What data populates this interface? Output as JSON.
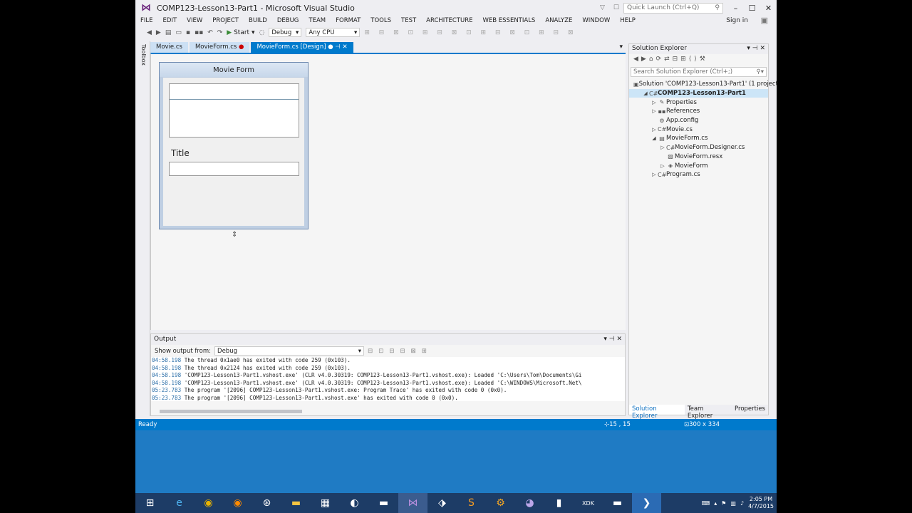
{
  "window": {
    "title": "COMP123-Lesson13-Part1 - Microsoft Visual Studio",
    "quick_launch_placeholder": "Quick Launch (Ctrl+Q)",
    "sign_in": "Sign in"
  },
  "menu": [
    "FILE",
    "EDIT",
    "VIEW",
    "PROJECT",
    "BUILD",
    "DEBUG",
    "TEAM",
    "FORMAT",
    "TOOLS",
    "TEST",
    "ARCHITECTURE",
    "WEB ESSENTIALS",
    "ANALYZE",
    "WINDOW",
    "HELP"
  ],
  "toolbar": {
    "start_label": "Start",
    "config": "Debug",
    "platform": "Any CPU"
  },
  "toolbox_label": "Toolbox",
  "doc_tabs": [
    {
      "label": "Movie.cs"
    },
    {
      "label": "MovieForm.cs"
    },
    {
      "label": "MovieForm.cs [Design]"
    }
  ],
  "designer": {
    "form_title": "Movie Form",
    "label_text": "Title"
  },
  "output": {
    "header": "Output",
    "show_from_label": "Show output from:",
    "source": "Debug",
    "lines": [
      {
        "ts": "04:58.198",
        "text": " The thread 0x1ae0 has exited with code 259 (0x103)."
      },
      {
        "ts": "04:58.198",
        "text": " The thread 0x2124 has exited with code 259 (0x103)."
      },
      {
        "ts": "04:58.198",
        "text": " 'COMP123-Lesson13-Part1.vshost.exe' (CLR v4.0.30319: COMP123-Lesson13-Part1.vshost.exe): Loaded 'C:\\Users\\Tom\\Documents\\Gi"
      },
      {
        "ts": "04:58.198",
        "text": " 'COMP123-Lesson13-Part1.vshost.exe' (CLR v4.0.30319: COMP123-Lesson13-Part1.vshost.exe): Loaded 'C:\\WINDOWS\\Microsoft.Net\\"
      },
      {
        "ts": "05:23.783",
        "text": " The program '[2096] COMP123-Lesson13-Part1.vshost.exe: Program Trace' has exited with code 0 (0x0)."
      },
      {
        "ts": "05:23.783",
        "text": " The program '[2096] COMP123-Lesson13-Part1.vshost.exe' has exited with code 0 (0x0)."
      }
    ]
  },
  "solution_explorer": {
    "header": "Solution Explorer",
    "search_placeholder": "Search Solution Explorer (Ctrl+;)",
    "items": [
      {
        "label": "Solution 'COMP123-Lesson13-Part1' (1 project",
        "indent": 0,
        "expander": "",
        "icon": "solution-icon"
      },
      {
        "label": "COMP123-Lesson13-Part1",
        "indent": 1,
        "expander": "◢",
        "icon": "csharp-project-icon",
        "selected": true
      },
      {
        "label": "Properties",
        "indent": 2,
        "expander": "▷",
        "icon": "wrench-icon"
      },
      {
        "label": "References",
        "indent": 2,
        "expander": "▷",
        "icon": "references-icon"
      },
      {
        "label": "App.config",
        "indent": 2,
        "expander": "",
        "icon": "config-icon"
      },
      {
        "label": "Movie.cs",
        "indent": 2,
        "expander": "▷",
        "icon": "csharp-file-icon"
      },
      {
        "label": "MovieForm.cs",
        "indent": 2,
        "expander": "◢",
        "icon": "form-icon"
      },
      {
        "label": "MovieForm.Designer.cs",
        "indent": 3,
        "expander": "▷",
        "icon": "csharp-file-icon"
      },
      {
        "label": "MovieForm.resx",
        "indent": 3,
        "expander": "",
        "icon": "resx-icon"
      },
      {
        "label": "MovieForm",
        "indent": 3,
        "expander": "▷",
        "icon": "class-icon"
      },
      {
        "label": "Program.cs",
        "indent": 2,
        "expander": "▷",
        "icon": "csharp-file-icon"
      }
    ],
    "bottom_tabs": [
      "Solution Explorer",
      "Team Explorer",
      "Properties"
    ]
  },
  "status": {
    "text": "Ready",
    "position": "15 , 15",
    "size": "300 x 334"
  },
  "clock": {
    "time": "2:05 PM",
    "date": "4/7/2015"
  },
  "colors": {
    "accent": "#007acc",
    "desktop": "#1f7bc4",
    "taskbar": "#1d3c66"
  }
}
